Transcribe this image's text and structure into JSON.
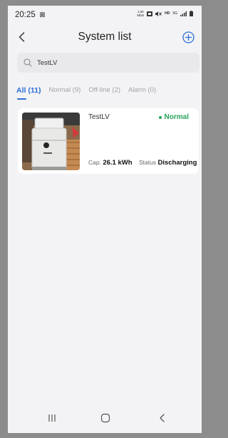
{
  "status_bar": {
    "time": "20:25",
    "recording_badge": "回",
    "speed": "1.00\nMb/s",
    "net_badge": "5G"
  },
  "header": {
    "title": "System list"
  },
  "search": {
    "value": "TestLV"
  },
  "tabs": [
    {
      "label": "All",
      "count": "(11)"
    },
    {
      "label": "Normal",
      "count": "(9)"
    },
    {
      "label": "Off-line",
      "count": "(2)"
    },
    {
      "label": "Alarm",
      "count": "(0)"
    }
  ],
  "systems": [
    {
      "name": "TestLV",
      "status": "Normal",
      "cap_label": "Cap.",
      "cap_value": "26.1 kWh",
      "status_label": "Status",
      "status_value": "Discharging",
      "status_color": "#27a35a"
    }
  ],
  "colors": {
    "accent": "#2b6fd6",
    "normal": "#27a35a"
  },
  "icons": [
    "back-arrow-icon",
    "add-circle-icon",
    "search-icon",
    "recent-apps-icon",
    "home-icon",
    "back-nav-icon"
  ]
}
